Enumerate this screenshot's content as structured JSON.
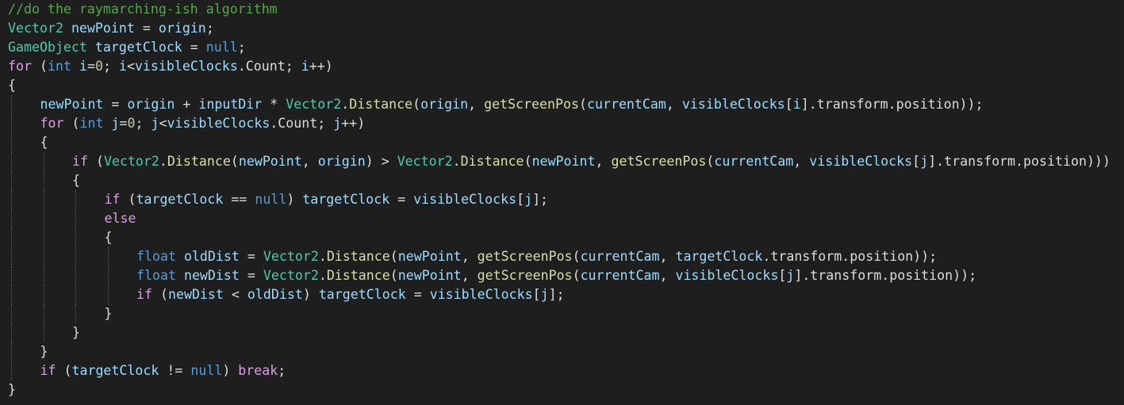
{
  "editor": {
    "language": "C#",
    "theme": {
      "background": "#1e1e1e",
      "comment": "#57a64a",
      "keyword": "#569cd6",
      "control": "#d8a0df",
      "type": "#4ec9b0",
      "variable": "#9cdcfe",
      "method": "#dcdcaa",
      "number": "#b5cea8",
      "plain": "#dcdcdc",
      "indent_guide": "#5a5a5a"
    },
    "lines": [
      {
        "indent": 0,
        "tokens": [
          {
            "t": "//do the raymarching-ish algorithm",
            "c": "comment"
          }
        ]
      },
      {
        "indent": 0,
        "tokens": [
          {
            "t": "Vector2",
            "c": "type"
          },
          {
            "t": " ",
            "c": "plain"
          },
          {
            "t": "newPoint",
            "c": "variable"
          },
          {
            "t": " = ",
            "c": "plain"
          },
          {
            "t": "origin",
            "c": "variable"
          },
          {
            "t": ";",
            "c": "plain"
          }
        ]
      },
      {
        "indent": 0,
        "tokens": [
          {
            "t": "GameObject",
            "c": "type"
          },
          {
            "t": " ",
            "c": "plain"
          },
          {
            "t": "targetClock",
            "c": "variable"
          },
          {
            "t": " = ",
            "c": "plain"
          },
          {
            "t": "null",
            "c": "keyword"
          },
          {
            "t": ";",
            "c": "plain"
          }
        ]
      },
      {
        "indent": 0,
        "tokens": [
          {
            "t": "for",
            "c": "control"
          },
          {
            "t": " (",
            "c": "plain"
          },
          {
            "t": "int",
            "c": "keyword"
          },
          {
            "t": " ",
            "c": "plain"
          },
          {
            "t": "i",
            "c": "variable"
          },
          {
            "t": "=",
            "c": "plain"
          },
          {
            "t": "0",
            "c": "number"
          },
          {
            "t": "; ",
            "c": "plain"
          },
          {
            "t": "i",
            "c": "variable"
          },
          {
            "t": "<",
            "c": "plain"
          },
          {
            "t": "visibleClocks",
            "c": "variable"
          },
          {
            "t": ".Count; ",
            "c": "plain"
          },
          {
            "t": "i",
            "c": "variable"
          },
          {
            "t": "++)",
            "c": "plain"
          }
        ]
      },
      {
        "indent": 0,
        "tokens": [
          {
            "t": "{",
            "c": "plain"
          }
        ]
      },
      {
        "indent": 1,
        "tokens": [
          {
            "t": "newPoint",
            "c": "variable"
          },
          {
            "t": " = ",
            "c": "plain"
          },
          {
            "t": "origin",
            "c": "variable"
          },
          {
            "t": " + ",
            "c": "plain"
          },
          {
            "t": "inputDir",
            "c": "variable"
          },
          {
            "t": " * ",
            "c": "plain"
          },
          {
            "t": "Vector2",
            "c": "type"
          },
          {
            "t": ".",
            "c": "plain"
          },
          {
            "t": "Distance",
            "c": "method"
          },
          {
            "t": "(",
            "c": "plain"
          },
          {
            "t": "origin",
            "c": "variable"
          },
          {
            "t": ", ",
            "c": "plain"
          },
          {
            "t": "getScreenPos",
            "c": "method"
          },
          {
            "t": "(",
            "c": "plain"
          },
          {
            "t": "currentCam",
            "c": "variable"
          },
          {
            "t": ", ",
            "c": "plain"
          },
          {
            "t": "visibleClocks",
            "c": "variable"
          },
          {
            "t": "[",
            "c": "plain"
          },
          {
            "t": "i",
            "c": "variable"
          },
          {
            "t": "].transform.position));",
            "c": "plain"
          }
        ]
      },
      {
        "indent": 1,
        "tokens": [
          {
            "t": "for",
            "c": "control"
          },
          {
            "t": " (",
            "c": "plain"
          },
          {
            "t": "int",
            "c": "keyword"
          },
          {
            "t": " ",
            "c": "plain"
          },
          {
            "t": "j",
            "c": "variable"
          },
          {
            "t": "=",
            "c": "plain"
          },
          {
            "t": "0",
            "c": "number"
          },
          {
            "t": "; ",
            "c": "plain"
          },
          {
            "t": "j",
            "c": "variable"
          },
          {
            "t": "<",
            "c": "plain"
          },
          {
            "t": "visibleClocks",
            "c": "variable"
          },
          {
            "t": ".Count; ",
            "c": "plain"
          },
          {
            "t": "j",
            "c": "variable"
          },
          {
            "t": "++)",
            "c": "plain"
          }
        ]
      },
      {
        "indent": 1,
        "tokens": [
          {
            "t": "{",
            "c": "plain"
          }
        ]
      },
      {
        "indent": 2,
        "tokens": [
          {
            "t": "if",
            "c": "control"
          },
          {
            "t": " (",
            "c": "plain"
          },
          {
            "t": "Vector2",
            "c": "type"
          },
          {
            "t": ".",
            "c": "plain"
          },
          {
            "t": "Distance",
            "c": "method"
          },
          {
            "t": "(",
            "c": "plain"
          },
          {
            "t": "newPoint",
            "c": "variable"
          },
          {
            "t": ", ",
            "c": "plain"
          },
          {
            "t": "origin",
            "c": "variable"
          },
          {
            "t": ") > ",
            "c": "plain"
          },
          {
            "t": "Vector2",
            "c": "type"
          },
          {
            "t": ".",
            "c": "plain"
          },
          {
            "t": "Distance",
            "c": "method"
          },
          {
            "t": "(",
            "c": "plain"
          },
          {
            "t": "newPoint",
            "c": "variable"
          },
          {
            "t": ", ",
            "c": "plain"
          },
          {
            "t": "getScreenPos",
            "c": "method"
          },
          {
            "t": "(",
            "c": "plain"
          },
          {
            "t": "currentCam",
            "c": "variable"
          },
          {
            "t": ", ",
            "c": "plain"
          },
          {
            "t": "visibleClocks",
            "c": "variable"
          },
          {
            "t": "[",
            "c": "plain"
          },
          {
            "t": "j",
            "c": "variable"
          },
          {
            "t": "].transform.position)))",
            "c": "plain"
          }
        ]
      },
      {
        "indent": 2,
        "tokens": [
          {
            "t": "{",
            "c": "plain"
          }
        ]
      },
      {
        "indent": 3,
        "tokens": [
          {
            "t": "if",
            "c": "control"
          },
          {
            "t": " (",
            "c": "plain"
          },
          {
            "t": "targetClock",
            "c": "variable"
          },
          {
            "t": " == ",
            "c": "plain"
          },
          {
            "t": "null",
            "c": "keyword"
          },
          {
            "t": ") ",
            "c": "plain"
          },
          {
            "t": "targetClock",
            "c": "variable"
          },
          {
            "t": " = ",
            "c": "plain"
          },
          {
            "t": "visibleClocks",
            "c": "variable"
          },
          {
            "t": "[",
            "c": "plain"
          },
          {
            "t": "j",
            "c": "variable"
          },
          {
            "t": "];",
            "c": "plain"
          }
        ]
      },
      {
        "indent": 3,
        "tokens": [
          {
            "t": "else",
            "c": "control"
          }
        ]
      },
      {
        "indent": 3,
        "tokens": [
          {
            "t": "{",
            "c": "plain"
          }
        ]
      },
      {
        "indent": 4,
        "tokens": [
          {
            "t": "float",
            "c": "keyword"
          },
          {
            "t": " ",
            "c": "plain"
          },
          {
            "t": "oldDist",
            "c": "variable"
          },
          {
            "t": " = ",
            "c": "plain"
          },
          {
            "t": "Vector2",
            "c": "type"
          },
          {
            "t": ".",
            "c": "plain"
          },
          {
            "t": "Distance",
            "c": "method"
          },
          {
            "t": "(",
            "c": "plain"
          },
          {
            "t": "newPoint",
            "c": "variable"
          },
          {
            "t": ", ",
            "c": "plain"
          },
          {
            "t": "getScreenPos",
            "c": "method"
          },
          {
            "t": "(",
            "c": "plain"
          },
          {
            "t": "currentCam",
            "c": "variable"
          },
          {
            "t": ", ",
            "c": "plain"
          },
          {
            "t": "targetClock",
            "c": "variable"
          },
          {
            "t": ".transform.position));",
            "c": "plain"
          }
        ]
      },
      {
        "indent": 4,
        "tokens": [
          {
            "t": "float",
            "c": "keyword"
          },
          {
            "t": " ",
            "c": "plain"
          },
          {
            "t": "newDist",
            "c": "variable"
          },
          {
            "t": " = ",
            "c": "plain"
          },
          {
            "t": "Vector2",
            "c": "type"
          },
          {
            "t": ".",
            "c": "plain"
          },
          {
            "t": "Distance",
            "c": "method"
          },
          {
            "t": "(",
            "c": "plain"
          },
          {
            "t": "newPoint",
            "c": "variable"
          },
          {
            "t": ", ",
            "c": "plain"
          },
          {
            "t": "getScreenPos",
            "c": "method"
          },
          {
            "t": "(",
            "c": "plain"
          },
          {
            "t": "currentCam",
            "c": "variable"
          },
          {
            "t": ", ",
            "c": "plain"
          },
          {
            "t": "visibleClocks",
            "c": "variable"
          },
          {
            "t": "[",
            "c": "plain"
          },
          {
            "t": "j",
            "c": "variable"
          },
          {
            "t": "].transform.position));",
            "c": "plain"
          }
        ]
      },
      {
        "indent": 4,
        "tokens": [
          {
            "t": "if",
            "c": "control"
          },
          {
            "t": " (",
            "c": "plain"
          },
          {
            "t": "newDist",
            "c": "variable"
          },
          {
            "t": " < ",
            "c": "plain"
          },
          {
            "t": "oldDist",
            "c": "variable"
          },
          {
            "t": ") ",
            "c": "plain"
          },
          {
            "t": "targetClock",
            "c": "variable"
          },
          {
            "t": " = ",
            "c": "plain"
          },
          {
            "t": "visibleClocks",
            "c": "variable"
          },
          {
            "t": "[",
            "c": "plain"
          },
          {
            "t": "j",
            "c": "variable"
          },
          {
            "t": "];",
            "c": "plain"
          }
        ]
      },
      {
        "indent": 3,
        "tokens": [
          {
            "t": "}",
            "c": "plain"
          }
        ]
      },
      {
        "indent": 2,
        "tokens": [
          {
            "t": "}",
            "c": "plain"
          }
        ]
      },
      {
        "indent": 1,
        "tokens": [
          {
            "t": "}",
            "c": "plain"
          }
        ]
      },
      {
        "indent": 1,
        "tokens": [
          {
            "t": "if",
            "c": "control"
          },
          {
            "t": " (",
            "c": "plain"
          },
          {
            "t": "targetClock",
            "c": "variable"
          },
          {
            "t": " != ",
            "c": "plain"
          },
          {
            "t": "null",
            "c": "keyword"
          },
          {
            "t": ") ",
            "c": "plain"
          },
          {
            "t": "break",
            "c": "control"
          },
          {
            "t": ";",
            "c": "plain"
          }
        ]
      },
      {
        "indent": 0,
        "tokens": [
          {
            "t": "}",
            "c": "plain"
          }
        ]
      }
    ]
  }
}
